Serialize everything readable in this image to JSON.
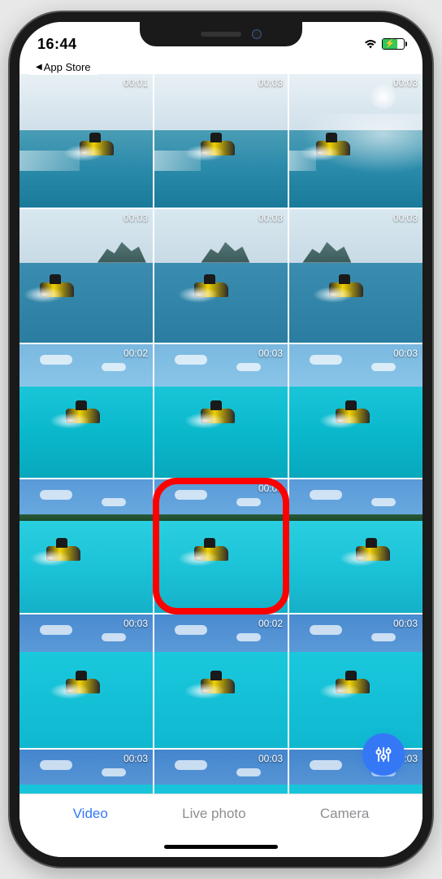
{
  "status": {
    "time": "16:44",
    "back_link": "App Store"
  },
  "thumbnails": [
    {
      "duration": "00:01",
      "variant": "bright-right"
    },
    {
      "duration": "00:03",
      "variant": "bright-center"
    },
    {
      "duration": "00:03",
      "variant": "bright-sun"
    },
    {
      "duration": "00:03",
      "variant": "mountain-left"
    },
    {
      "duration": "00:03",
      "variant": "mountain-center"
    },
    {
      "duration": "00:03",
      "variant": "mountain-right"
    },
    {
      "duration": "00:02",
      "variant": "turquoise-left"
    },
    {
      "duration": "00:03",
      "variant": "turquoise-center"
    },
    {
      "duration": "00:03",
      "variant": "turquoise-right"
    },
    {
      "duration": "",
      "variant": "lagoon-left"
    },
    {
      "duration": "00:03",
      "variant": "lagoon-center",
      "highlighted": true
    },
    {
      "duration": "",
      "variant": "lagoon-right"
    },
    {
      "duration": "00:03",
      "variant": "clear-left"
    },
    {
      "duration": "00:02",
      "variant": "clear-center"
    },
    {
      "duration": "00:03",
      "variant": "clear-right"
    },
    {
      "duration": "00:03",
      "variant": "bottom-left"
    },
    {
      "duration": "00:03",
      "variant": "bottom-center"
    },
    {
      "duration": "00:03",
      "variant": "bottom-right"
    }
  ],
  "tabs": [
    {
      "label": "Video",
      "active": true
    },
    {
      "label": "Live photo",
      "active": false
    },
    {
      "label": "Camera",
      "active": false
    }
  ],
  "icons": {
    "back_arrow": "◀",
    "wifi": "wifi",
    "battery": "battery",
    "settings": "sliders"
  }
}
